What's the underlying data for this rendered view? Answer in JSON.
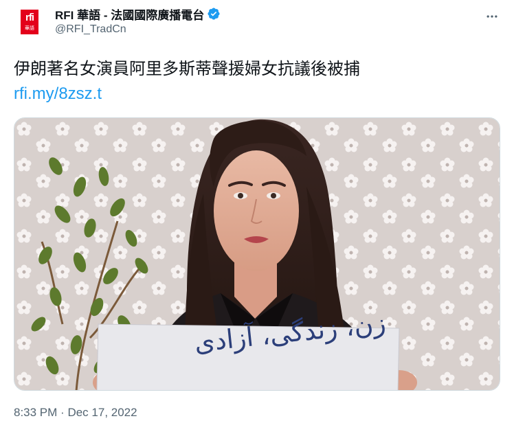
{
  "account": {
    "display_name": "RFI 華語 - 法國國際廣播電台",
    "handle": "@RFI_TradCn",
    "avatar_logo": "rfi",
    "avatar_sub": "華語",
    "verified_icon": "verified-badge-icon",
    "brand_color": "#e3001b",
    "verified_color": "#1d9bf0"
  },
  "tweet": {
    "text": "伊朗著名女演員阿里多斯蒂聲援婦女抗議後被捕",
    "link": "rfi.my/8zsz.t",
    "link_color": "#1d9bf0"
  },
  "media": {
    "sign_text": "زن، زندگی، آزادی"
  },
  "meta": {
    "time": "8:33 PM",
    "separator": "·",
    "date": "Dec 17, 2022"
  },
  "actions": {
    "more_icon": "more-horizontal-icon"
  }
}
